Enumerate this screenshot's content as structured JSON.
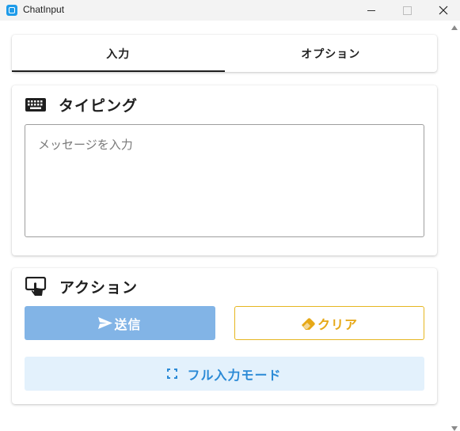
{
  "window": {
    "title": "ChatInput",
    "controls": [
      "minimize",
      "maximize",
      "close"
    ]
  },
  "tabs": [
    {
      "label": "入力",
      "active": true
    },
    {
      "label": "オプション",
      "active": false
    }
  ],
  "typing": {
    "icon": "keyboard-icon",
    "title": "タイピング",
    "placeholder": "メッセージを入力"
  },
  "actions": {
    "icon": "touch-screen-icon",
    "title": "アクション",
    "send": {
      "label": "送信",
      "icon": "send-icon",
      "color": "#82b4e6"
    },
    "clear": {
      "label": "クリア",
      "icon": "eraser-icon",
      "color": "#e6b620"
    },
    "fullscreen": {
      "label": "フル入力モード",
      "icon": "fullscreen-icon",
      "color": "#2b8ad6"
    }
  }
}
